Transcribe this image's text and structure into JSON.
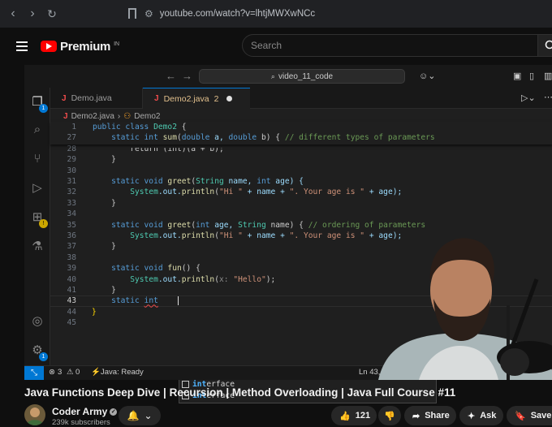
{
  "browser": {
    "url": "youtube.com/watch?v=lhtjMWXwNCc"
  },
  "youtube": {
    "brand": "Premium",
    "region": "IN",
    "search_placeholder": "Search",
    "video_title": "Java Functions Deep Dive | Recursion | Method Overloading | Java Full Course #11",
    "channel_name": "Coder Army",
    "subscribers": "239k subscribers",
    "like_count": "121",
    "share_label": "Share",
    "ask_label": "Ask",
    "save_label": "Save"
  },
  "editor": {
    "command_center": "video_11_code",
    "tabs": [
      {
        "icon": "J",
        "label": "Demo.java",
        "modified": ""
      },
      {
        "icon": "J",
        "label": "Demo2.java",
        "modified": "2"
      }
    ],
    "breadcrumb": [
      "Demo2.java",
      "Demo2"
    ],
    "explorer_badge": "1",
    "settings_badge": "1",
    "line_numbers": [
      "1",
      "27",
      "28",
      "29",
      "30",
      "31",
      "32",
      "33",
      "34",
      "35",
      "36",
      "37",
      "38",
      "39",
      "40",
      "41",
      "42",
      "43",
      "44",
      "45"
    ],
    "current_line": "43",
    "code": {
      "l1": [
        "public class ",
        "Demo2",
        " {"
      ],
      "l27": [
        "    static int ",
        "sum",
        "(",
        "double",
        " a, ",
        "double",
        " b) { ",
        "// different types of parameters"
      ],
      "l28": "        return (int)(a + b);",
      "l29": "    }",
      "l31": [
        "    static void ",
        "greet",
        "(",
        "String",
        " name, ",
        "int",
        " age) {"
      ],
      "l32": [
        "        System",
        ".out.",
        "println",
        "(",
        "\"Hi \"",
        " + name + ",
        "\". Your age is \"",
        " + age);"
      ],
      "l33": "    }",
      "l35": [
        "    static void ",
        "greet",
        "(",
        "int",
        " age, ",
        "String",
        " name) { ",
        "// ordering of parameters"
      ],
      "l36": [
        "        System",
        ".out.",
        "println",
        "(",
        "\"Hi \"",
        " + name + ",
        "\". Your age is \"",
        " + age);"
      ],
      "l37": "    }",
      "l39": [
        "    static void ",
        "fun",
        "() {"
      ],
      "l40": [
        "        System",
        ".out.",
        "println",
        "(",
        "x: ",
        "\"Hello\"",
        ");"
      ],
      "l41": "    }",
      "l43": [
        "    static ",
        "int"
      ],
      "l44": "}"
    },
    "suggestions": [
      {
        "match": "int",
        "rest": ""
      },
      {
        "match": "int",
        "rest": "erface"
      },
      {
        "match": "int",
        "rest": "erface"
      }
    ],
    "status": {
      "errors": "3",
      "warnings": "0",
      "java": "Java: Ready",
      "position": "Ln 43, Col"
    }
  },
  "colors": {
    "accent": "#0078d4",
    "keyword": "#569cd6",
    "type": "#4ec9b0",
    "function": "#dcdcaa",
    "string": "#ce9178",
    "comment": "#6a9955",
    "youtube_red": "#ff0000"
  }
}
